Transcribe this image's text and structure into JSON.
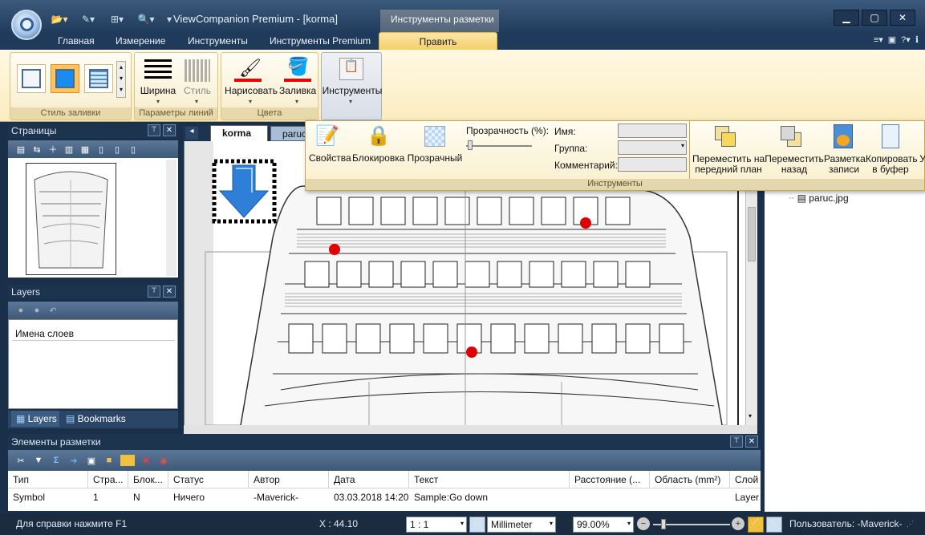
{
  "window": {
    "title": "ViewCompanion Premium - [korma]",
    "context_tab_header": "Инструменты разметки",
    "controls": [
      "▁",
      "▢",
      "✕"
    ]
  },
  "ribbon_tabs": [
    "Главная",
    "Измерение",
    "Инструменты",
    "Инструменты Premium",
    "Править"
  ],
  "ribbon": {
    "fill_style_group": "Стиль заливки",
    "line_params_group": "Параметры линий",
    "line_width": "Ширина",
    "line_style": "Стиль",
    "colors_group": "Цвета",
    "draw": "Нарисовать",
    "fill": "Заливка",
    "tools": "Инструменты"
  },
  "tools_popup": {
    "properties": "Свойства",
    "lock": "Блокировка",
    "transparent": "Прозрачный",
    "transparency_label": "Прозрачность (%):",
    "name_label": "Имя:",
    "group_label": "Группа:",
    "comment_label": "Комментарий:",
    "bring_front": "Переместить на\nпередний план",
    "send_back": "Переместить\nназад",
    "markup_record": "Разметка\nзаписи",
    "copy_buffer": "Копировать\nв буфер",
    "group_title": "Инструменты"
  },
  "panels": {
    "pages_title": "Страницы",
    "layers_title": "Layers",
    "layer_names_header": "Имена слоев",
    "layers_tab": "Layers",
    "bookmarks_tab": "Bookmarks"
  },
  "documents": {
    "tabs": [
      "korma",
      "paruc"
    ],
    "right_panel_file": "paruc.jpg"
  },
  "markup_list": {
    "title": "Элементы разметки",
    "columns": [
      "Тип",
      "Стра...",
      "Блок...",
      "Статус",
      "Автор",
      "Дата",
      "Текст",
      "Расстояние (...",
      "Область (mm²)",
      "Слой"
    ],
    "rows": [
      [
        "Symbol",
        "1",
        "N",
        "Ничего",
        "-Maverick-",
        "03.03.2018 14:20",
        "Sample:Go down",
        "",
        "",
        "Layer"
      ]
    ]
  },
  "status": {
    "help": "Для справки нажмите F1",
    "x_coord": "X : 44.10",
    "scale": "1 : 1",
    "units": "Millimeter",
    "zoom": "99.00%",
    "user": "Пользователь: -Maverick-"
  },
  "colors": {
    "accent_tab": "#f4cf6a",
    "markup_dot": "#e00000",
    "arrow_blue": "#2d7fd8",
    "window_frame": "#1d344f"
  }
}
